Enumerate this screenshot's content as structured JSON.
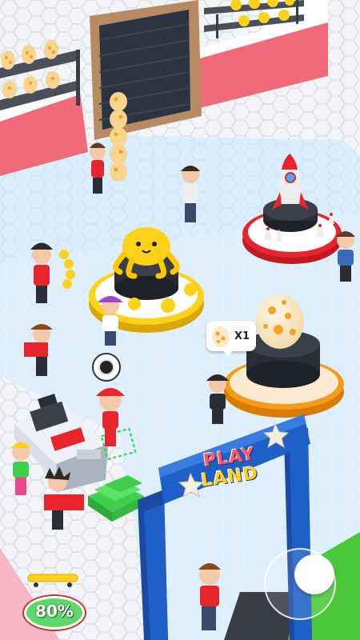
{
  "hud": {
    "progress_label": "80%",
    "progress_value": 0.8,
    "egg_badge_count": "X1",
    "sign_line1": "PLAY",
    "sign_line2": "LAND"
  },
  "colors": {
    "floor_blue": "#d9ecfb",
    "hex_tile": "#eaeef4",
    "wall_pink": "#f06a7a",
    "stand_yellow": "#ffd21a",
    "stand_orange": "#f59b1c",
    "stand_red": "#e8242c",
    "arch_blue": "#1e5fc8",
    "cash_green": "#3fcf4a",
    "progress_green": "#5fd86a"
  },
  "icons": [
    "egg-icon",
    "octopus-icon",
    "rocket-icon",
    "joystick-icon",
    "cash-stack-icon",
    "skateboard-icon",
    "cash-register-icon",
    "star-icon"
  ]
}
